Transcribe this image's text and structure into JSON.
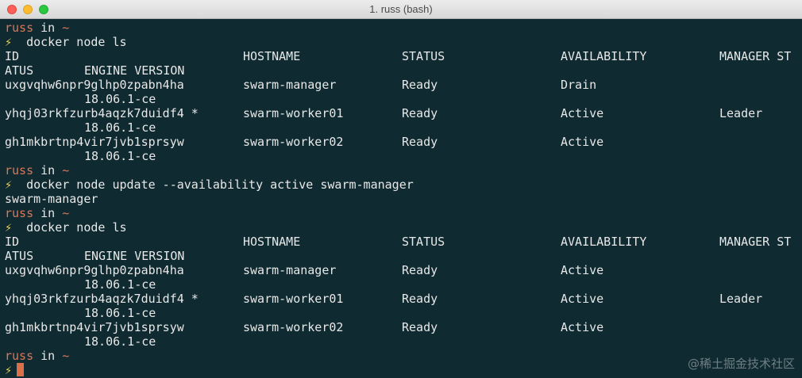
{
  "window": {
    "title": "1. russ (bash)"
  },
  "prompt": {
    "user": "russ",
    "in": "in",
    "dir": "~",
    "symbol": "⚡"
  },
  "cmd1": "docker node ls",
  "headers": {
    "id": "ID",
    "hostname": "HOSTNAME",
    "status": "STATUS",
    "availability": "AVAILABILITY",
    "manager_part1": "MANAGER ST",
    "manager_part2": "ATUS",
    "engine": "ENGINE VERSION"
  },
  "table1": [
    {
      "id": "uxgvqhw6npr9glhp0zpabn4ha",
      "hostname": "swarm-manager",
      "status": "Ready",
      "availability": "Drain",
      "manager": "",
      "engine": "18.06.1-ce"
    },
    {
      "id": "yhqj03rkfzurb4aqzk7duidf4 *",
      "hostname": "swarm-worker01",
      "status": "Ready",
      "availability": "Active",
      "manager": "Leader",
      "engine": "18.06.1-ce"
    },
    {
      "id": "gh1mkbrtnp4vir7jvb1sprsyw",
      "hostname": "swarm-worker02",
      "status": "Ready",
      "availability": "Active",
      "manager": "",
      "engine": "18.06.1-ce"
    }
  ],
  "cmd2": "docker node update --availability active swarm-manager",
  "cmd2_output": "swarm-manager",
  "cmd3": "docker node ls",
  "table2": [
    {
      "id": "uxgvqhw6npr9glhp0zpabn4ha",
      "hostname": "swarm-manager",
      "status": "Ready",
      "availability": "Active",
      "manager": "",
      "engine": "18.06.1-ce"
    },
    {
      "id": "yhqj03rkfzurb4aqzk7duidf4 *",
      "hostname": "swarm-worker01",
      "status": "Ready",
      "availability": "Active",
      "manager": "Leader",
      "engine": "18.06.1-ce"
    },
    {
      "id": "gh1mkbrtnp4vir7jvb1sprsyw",
      "hostname": "swarm-worker02",
      "status": "Ready",
      "availability": "Active",
      "manager": "",
      "engine": "18.06.1-ce"
    }
  ],
  "watermark": "@稀土掘金技术社区"
}
